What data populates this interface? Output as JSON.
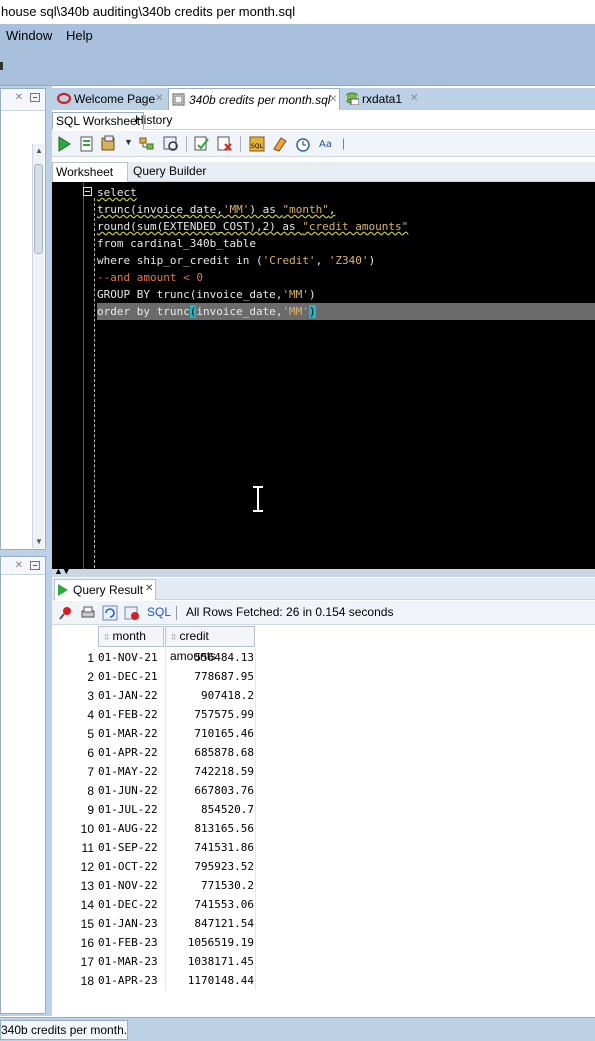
{
  "window": {
    "title": "house sql\\340b auditing\\340b credits per month.sql"
  },
  "menu": {
    "items": [
      "Window",
      "Help"
    ]
  },
  "doc_tabs": [
    {
      "label": "Welcome Page",
      "icon": "oracle-icon"
    },
    {
      "label": "340b credits per month.sql",
      "icon": "sql-file-icon"
    },
    {
      "label": "rxdata1",
      "icon": "db-connection-icon"
    }
  ],
  "sub_tabs": [
    "SQL Worksheet",
    "History"
  ],
  "worksheet_tabs": [
    "Worksheet",
    "Query Builder"
  ],
  "editor": {
    "lines": [
      "select",
      "trunc(invoice_date,'MM') as \"month\",",
      "round(sum(EXTENDED_COST),2) as \"credit amounts\"",
      "from cardinal_340b_table",
      "where ship_or_credit in ('Credit', 'Z340')",
      "--and amount < 0",
      "GROUP BY trunc(invoice_date,'MM')",
      "order by trunc(invoice_date,'MM')"
    ]
  },
  "result": {
    "tab_label": "Query Result",
    "sql_link": "SQL",
    "status": "All Rows Fetched: 26 in 0.154 seconds",
    "columns": [
      "month",
      "credit amounts"
    ],
    "rows": [
      [
        "1",
        "01-NOV-21",
        "556484.13"
      ],
      [
        "2",
        "01-DEC-21",
        "778687.95"
      ],
      [
        "3",
        "01-JAN-22",
        "907418.2"
      ],
      [
        "4",
        "01-FEB-22",
        "757575.99"
      ],
      [
        "5",
        "01-MAR-22",
        "710165.46"
      ],
      [
        "6",
        "01-APR-22",
        "685878.68"
      ],
      [
        "7",
        "01-MAY-22",
        "742218.59"
      ],
      [
        "8",
        "01-JUN-22",
        "667803.76"
      ],
      [
        "9",
        "01-JUL-22",
        "854520.7"
      ],
      [
        "10",
        "01-AUG-22",
        "813165.56"
      ],
      [
        "11",
        "01-SEP-22",
        "741531.86"
      ],
      [
        "12",
        "01-OCT-22",
        "795923.52"
      ],
      [
        "13",
        "01-NOV-22",
        "771530.2"
      ],
      [
        "14",
        "01-DEC-22",
        "741553.06"
      ],
      [
        "15",
        "01-JAN-23",
        "847121.54"
      ],
      [
        "16",
        "01-FEB-23",
        "1056519.19"
      ],
      [
        "17",
        "01-MAR-23",
        "1038171.45"
      ],
      [
        "18",
        "01-APR-23",
        "1170148.44"
      ]
    ]
  },
  "statusbar": {
    "file_tab": "340b credits per month.sql"
  }
}
